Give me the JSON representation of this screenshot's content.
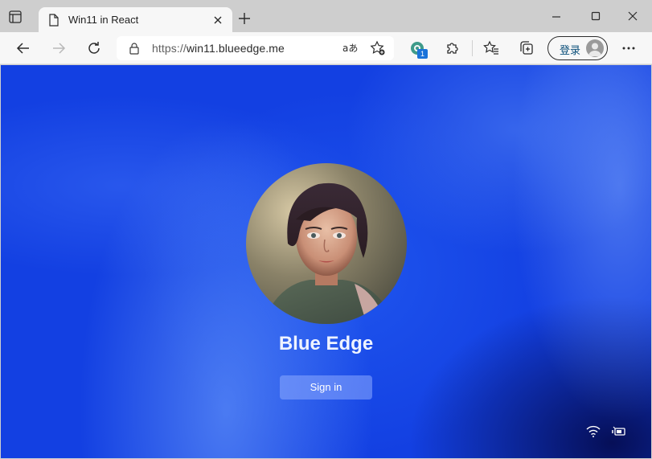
{
  "browser": {
    "tab": {
      "title": "Win11 in React"
    },
    "address_bar": {
      "scheme": "https://",
      "host": "win11.blueedge.me"
    },
    "extension_badge": "1",
    "signin_label": "登录",
    "icons": {
      "tab_actions": "tab-actions-icon",
      "page": "page-icon",
      "close_tab": "close-icon",
      "new_tab": "plus-icon",
      "minimize": "minimize-icon",
      "maximize": "maximize-icon",
      "close_window": "close-icon",
      "back": "back-arrow-icon",
      "forward": "forward-arrow-icon",
      "refresh": "refresh-icon",
      "lock": "lock-icon",
      "read_aloud": "read-aloud-icon",
      "add_favorite": "add-favorite-icon",
      "extension": "extension-icon",
      "extensions": "puzzle-icon",
      "favorites": "favorites-icon",
      "collections": "collections-icon",
      "more": "more-icon"
    }
  },
  "lock_screen": {
    "user_name": "Blue Edge",
    "signin_button": "Sign in",
    "tray": {
      "wifi": "wifi-icon",
      "battery": "battery-icon"
    },
    "colors": {
      "background": "#1437df",
      "accent": "#1f55ee"
    }
  }
}
